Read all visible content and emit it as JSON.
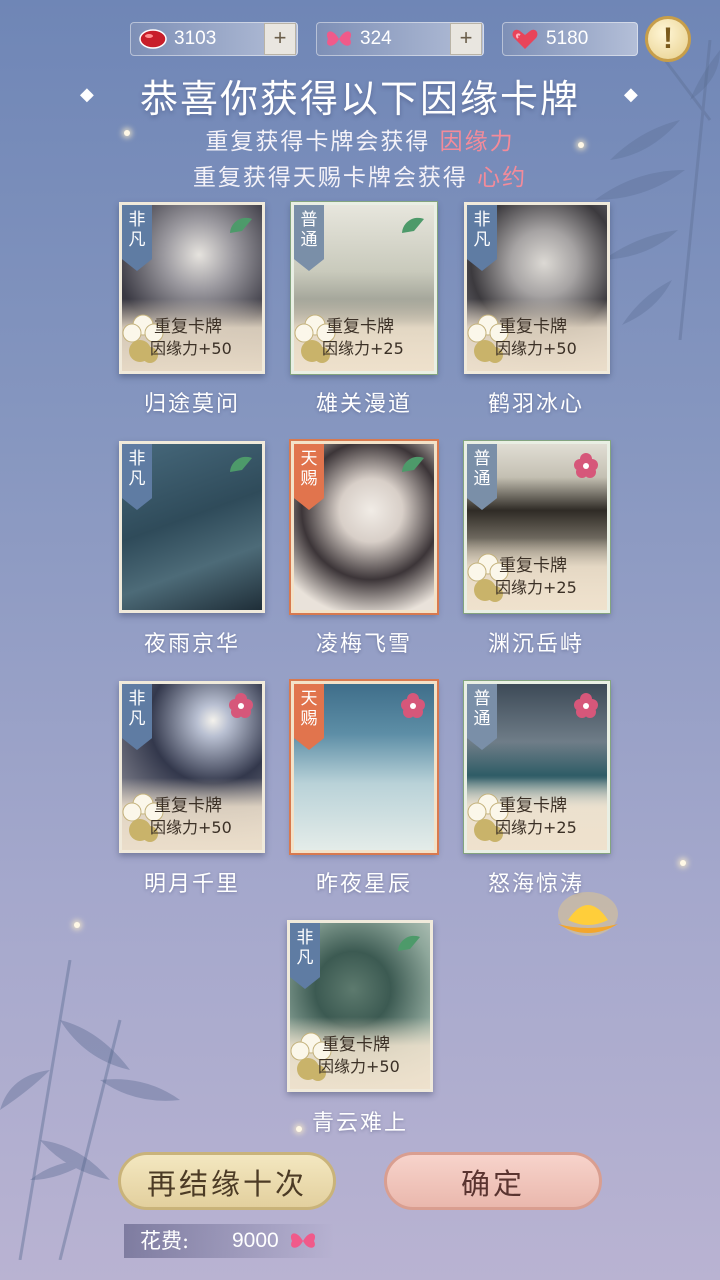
{
  "resources": [
    {
      "icon": "red-gem-icon",
      "value": "3103",
      "has_plus": true
    },
    {
      "icon": "butterfly-icon",
      "value": "324",
      "has_plus": true
    },
    {
      "icon": "heart-icon",
      "value": "5180",
      "has_plus": false
    }
  ],
  "info_button": "!",
  "title": "恭喜你获得以下因缘卡牌",
  "subtitle1": {
    "text": "重复获得卡牌会获得",
    "highlight": "因缘力"
  },
  "subtitle2": {
    "text": "重复获得天赐卡牌会获得",
    "highlight": "心约"
  },
  "cards": [
    {
      "name": "归途莫问",
      "rarity": "非凡",
      "dupe": true,
      "dupe_label": "重复卡牌",
      "dupe_value": "因缘力+50"
    },
    {
      "name": "雄关漫道",
      "rarity": "普通",
      "dupe": true,
      "dupe_label": "重复卡牌",
      "dupe_value": "因缘力+25"
    },
    {
      "name": "鹤羽冰心",
      "rarity": "非凡",
      "dupe": true,
      "dupe_label": "重复卡牌",
      "dupe_value": "因缘力+50"
    },
    {
      "name": "夜雨京华",
      "rarity": "非凡",
      "dupe": false
    },
    {
      "name": "凌梅飞雪",
      "rarity": "天赐",
      "dupe": false
    },
    {
      "name": "渊沉岳峙",
      "rarity": "普通",
      "dupe": true,
      "dupe_label": "重复卡牌",
      "dupe_value": "因缘力+25"
    },
    {
      "name": "明月千里",
      "rarity": "非凡",
      "dupe": true,
      "dupe_label": "重复卡牌",
      "dupe_value": "因缘力+50"
    },
    {
      "name": "昨夜星辰",
      "rarity": "天赐",
      "dupe": false
    },
    {
      "name": "怒海惊涛",
      "rarity": "普通",
      "dupe": true,
      "dupe_label": "重复卡牌",
      "dupe_value": "因缘力+25"
    },
    {
      "name": "青云难上",
      "rarity": "非凡",
      "dupe": true,
      "dupe_label": "重复卡牌",
      "dupe_value": "因缘力+50"
    }
  ],
  "buttons": {
    "again": "再结缘十次",
    "confirm": "确定"
  },
  "cost": {
    "label": "花费:",
    "value": "9000",
    "icon": "butterfly-icon"
  },
  "colors": {
    "highlight": "#f48b9a",
    "rarity_feifan": "#5f7ca3",
    "rarity_putong": "#7a8fa8",
    "rarity_tianci": "#e1744d"
  }
}
